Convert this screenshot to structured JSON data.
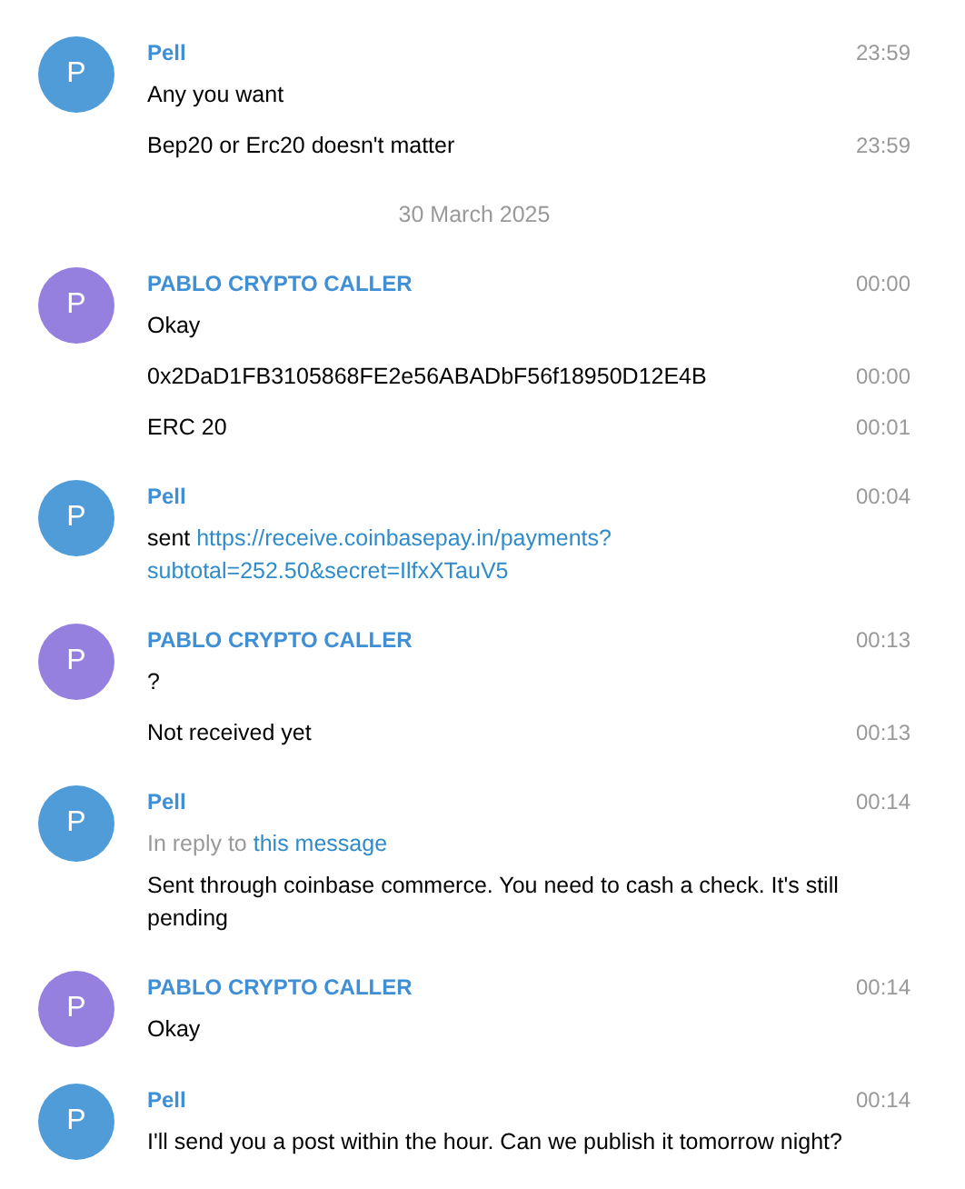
{
  "history": [
    {
      "kind": "group",
      "sender": "Pell",
      "avatar": "P",
      "color": "#4f9cd9",
      "time": "23:59",
      "messages": [
        {
          "text": "Any you want"
        },
        {
          "text": "Bep20 or Erc20 doesn't matter",
          "time": "23:59"
        }
      ]
    },
    {
      "kind": "date",
      "text": "30 March 2025"
    },
    {
      "kind": "group",
      "sender": "PABLO CRYPTO CALLER",
      "avatar": "P",
      "color": "#9580e0",
      "time": "00:00",
      "messages": [
        {
          "text": "Okay"
        },
        {
          "text": "0x2DaD1FB3105868FE2e56ABADbF56f18950D12E4B",
          "time": "00:00"
        },
        {
          "text": "ERC 20",
          "time": "00:01"
        }
      ]
    },
    {
      "kind": "group",
      "sender": "Pell",
      "avatar": "P",
      "color": "#4f9cd9",
      "time": "00:04",
      "messages": [
        {
          "text": "sent",
          "link_lines": [
            "https://receive.coinbasepay.in/payments?",
            "subtotal=252.50&secret=IlfxXTauV5"
          ]
        }
      ]
    },
    {
      "kind": "group",
      "sender": "PABLO CRYPTO CALLER",
      "avatar": "P",
      "color": "#9580e0",
      "time": "00:13",
      "messages": [
        {
          "text": "?"
        },
        {
          "text": "Not received yet",
          "time": "00:13"
        }
      ]
    },
    {
      "kind": "group",
      "sender": "Pell",
      "avatar": "P",
      "color": "#4f9cd9",
      "time": "00:14",
      "messages": [
        {
          "reply": {
            "prefix": "In reply to",
            "link": "this message"
          },
          "text": "Sent through coinbase commerce. You need to cash a check. It's still pending"
        }
      ]
    },
    {
      "kind": "group",
      "sender": "PABLO CRYPTO CALLER",
      "avatar": "P",
      "color": "#9580e0",
      "time": "00:14",
      "messages": [
        {
          "text": "Okay"
        }
      ]
    },
    {
      "kind": "group",
      "sender": "Pell",
      "avatar": "P",
      "color": "#4f9cd9",
      "time": "00:14",
      "messages": [
        {
          "text": "I'll send you a post within the hour. Can we publish it tomorrow night?"
        }
      ]
    }
  ]
}
